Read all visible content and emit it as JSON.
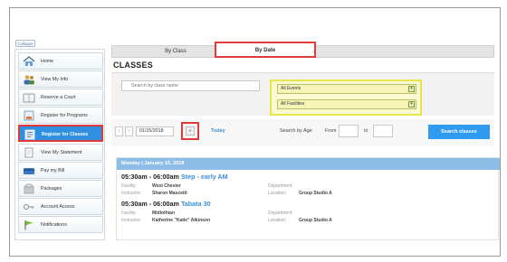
{
  "sidebar": {
    "collapse_label": "Collapse",
    "items": [
      {
        "label": "Home",
        "icon": "home-icon",
        "active": false
      },
      {
        "label": "View My Info",
        "icon": "people-icon",
        "active": false
      },
      {
        "label": "Reserve a Court",
        "icon": "court-icon",
        "active": false
      },
      {
        "label": "Register for Programs",
        "icon": "programs-icon",
        "active": false
      },
      {
        "label": "Register for Classes",
        "icon": "classes-icon",
        "active": true
      },
      {
        "label": "View My Statement",
        "icon": "statement-icon",
        "active": false
      },
      {
        "label": "Pay my Bill",
        "icon": "bill-icon",
        "active": false
      },
      {
        "label": "Packages",
        "icon": "packages-icon",
        "active": false
      },
      {
        "label": "Account Access",
        "icon": "key-icon",
        "active": false
      },
      {
        "label": "Notifications",
        "icon": "flag-icon",
        "active": false
      }
    ]
  },
  "tabs": {
    "by_class": "By Class",
    "by_date": "By Date"
  },
  "page_title": "CLASSES",
  "filters": {
    "search_placeholder": "Search by class name",
    "events_selected": "All Events",
    "facilities_selected": "All Facilities",
    "date_value": "01/15/2018",
    "today_label": "Today",
    "age_label": "Search by Age",
    "from_label": "From",
    "to_label": "to",
    "search_button": "Search classes"
  },
  "colors": {
    "accent": "#2e9bf0",
    "highlight_red": "#e03a3a",
    "highlight_yellow": "#e6e64a"
  },
  "results": {
    "day_header": "Monday | January 15, 2018",
    "classes": [
      {
        "time": "05:30am - 06:00am",
        "name": "Step - early AM",
        "facility_label": "Facility:",
        "facility": "West Chester",
        "instructor_label": "Instructor:",
        "instructor": "Sharon Mascetti",
        "department_label": "Department:",
        "department": "",
        "location_label": "Location:",
        "location": "Group Studio A"
      },
      {
        "time": "05:30am - 06:00am",
        "name": "Tabata 30",
        "facility_label": "Facility:",
        "facility": "Midlothian",
        "instructor_label": "Instructor:",
        "instructor": "Katherine \"Katie\" Atkinson",
        "department_label": "Department:",
        "department": "",
        "location_label": "Location:",
        "location": "Group Studio A"
      }
    ]
  }
}
